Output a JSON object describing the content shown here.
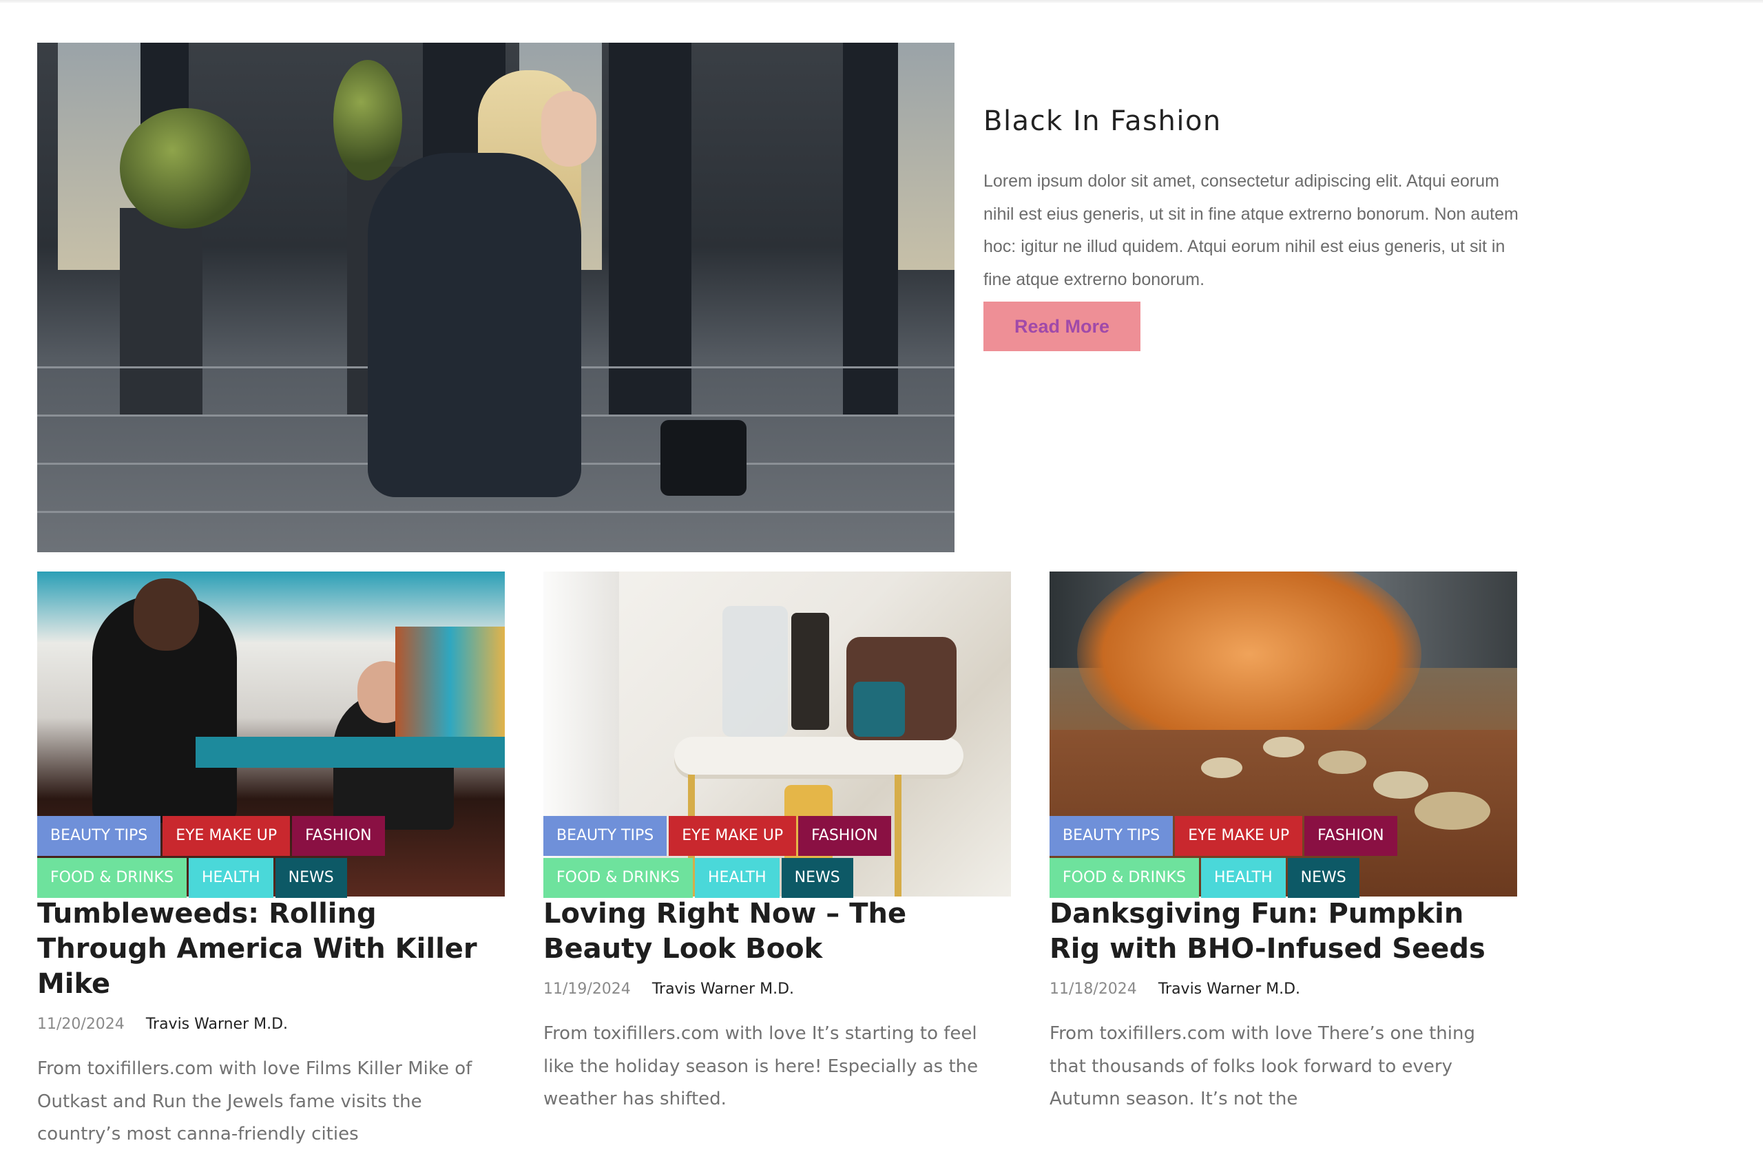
{
  "featured": {
    "title": "Black In Fashion",
    "excerpt": "Lorem ipsum dolor sit amet, consectetur adipiscing elit. Atqui eorum nihil est eius generis, ut sit in fine atque extrerno bonorum. Non autem hoc: igitur ne illud quidem. Atqui eorum nihil est eius generis, ut sit in fine atque extrerno bonorum.",
    "read_more_label": "Read More"
  },
  "colors": {
    "beauty_tips": "#6f90d9",
    "eye_make_up": "#c9282e",
    "fashion": "#8a1043",
    "food_drinks": "#6ee29d",
    "health": "#4ad8d9",
    "news": "#0d5966",
    "read_more_bg": "#ee8f96",
    "read_more_text": "#a04aa9"
  },
  "tags": {
    "row1": [
      "BEAUTY TIPS",
      "EYE MAKE UP",
      "FASHION"
    ],
    "row2": [
      "FOOD & DRINKS",
      "HEALTH",
      "NEWS"
    ]
  },
  "cards": [
    {
      "title": "Tumbleweeds: Rolling Through America With Killer Mike",
      "date": "11/20/2024",
      "author": "Travis Warner M.D.",
      "excerpt": "From toxifillers.com with love Films Killer Mike of Outkast and Run the Jewels fame visits the country’s most canna-friendly cities"
    },
    {
      "title": "Loving Right Now – The Beauty Look Book",
      "date": "11/19/2024",
      "author": "Travis Warner M.D.",
      "excerpt": "From toxifillers.com with love It’s starting to feel like the holiday season is here! Especially as the weather has shifted."
    },
    {
      "title": "Danksgiving Fun: Pumpkin Rig with BHO-Infused Seeds",
      "date": "11/18/2024",
      "author": "Travis Warner M.D.",
      "excerpt": "From toxifillers.com with love There’s one thing that thousands of folks look forward to every Autumn season. It’s not the"
    }
  ]
}
